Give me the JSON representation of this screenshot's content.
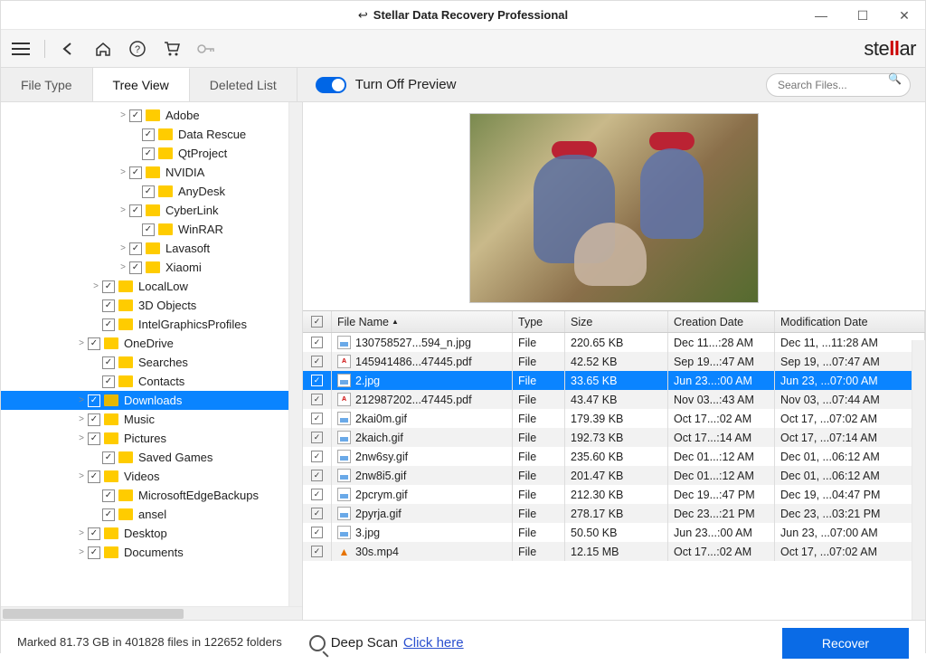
{
  "window": {
    "title": "Stellar Data Recovery Professional"
  },
  "brand": {
    "pre": "ste",
    "mid": "ll",
    "post": "ar"
  },
  "tabs": {
    "file_type": "File Type",
    "tree_view": "Tree View",
    "deleted_list": "Deleted List"
  },
  "preview_toggle_label": "Turn Off Preview",
  "search": {
    "placeholder": "Search Files..."
  },
  "tree": [
    {
      "indent": 128,
      "chev": ">",
      "label": "Adobe"
    },
    {
      "indent": 142,
      "chev": "",
      "label": "Data Rescue"
    },
    {
      "indent": 142,
      "chev": "",
      "label": "QtProject"
    },
    {
      "indent": 128,
      "chev": ">",
      "label": "NVIDIA"
    },
    {
      "indent": 142,
      "chev": "",
      "label": "AnyDesk"
    },
    {
      "indent": 128,
      "chev": ">",
      "label": "CyberLink"
    },
    {
      "indent": 142,
      "chev": "",
      "label": "WinRAR"
    },
    {
      "indent": 128,
      "chev": ">",
      "label": "Lavasoft"
    },
    {
      "indent": 128,
      "chev": ">",
      "label": "Xiaomi"
    },
    {
      "indent": 98,
      "chev": ">",
      "label": "LocalLow"
    },
    {
      "indent": 98,
      "chev": "",
      "label": "3D Objects"
    },
    {
      "indent": 98,
      "chev": "",
      "label": "IntelGraphicsProfiles"
    },
    {
      "indent": 82,
      "chev": ">",
      "label": "OneDrive"
    },
    {
      "indent": 98,
      "chev": "",
      "label": "Searches"
    },
    {
      "indent": 98,
      "chev": "",
      "label": "Contacts"
    },
    {
      "indent": 82,
      "chev": ">",
      "label": "Downloads",
      "selected": true,
      "open": true
    },
    {
      "indent": 82,
      "chev": ">",
      "label": "Music"
    },
    {
      "indent": 82,
      "chev": ">",
      "label": "Pictures"
    },
    {
      "indent": 98,
      "chev": "",
      "label": "Saved Games"
    },
    {
      "indent": 82,
      "chev": ">",
      "label": "Videos"
    },
    {
      "indent": 98,
      "chev": "",
      "label": "MicrosoftEdgeBackups"
    },
    {
      "indent": 98,
      "chev": "",
      "label": "ansel"
    },
    {
      "indent": 82,
      "chev": ">",
      "label": "Desktop"
    },
    {
      "indent": 82,
      "chev": ">",
      "label": "Documents"
    }
  ],
  "table": {
    "headers": {
      "name": "File Name",
      "type": "Type",
      "size": "Size",
      "cd": "Creation Date",
      "md": "Modification Date"
    },
    "rows": [
      {
        "icon": "img",
        "name": "130758527...594_n.jpg",
        "type": "File",
        "size": "220.65 KB",
        "cd": "Dec 11...:28 AM",
        "md": "Dec 11, ...11:28 AM"
      },
      {
        "icon": "pdf",
        "name": "145941486...47445.pdf",
        "type": "File",
        "size": "42.52 KB",
        "cd": "Sep 19...:47 AM",
        "md": "Sep 19, ...07:47 AM"
      },
      {
        "icon": "img",
        "name": "2.jpg",
        "type": "File",
        "size": "33.65 KB",
        "cd": "Jun 23...:00 AM",
        "md": "Jun 23, ...07:00 AM",
        "selected": true
      },
      {
        "icon": "pdf",
        "name": "212987202...47445.pdf",
        "type": "File",
        "size": "43.47 KB",
        "cd": "Nov 03...:43 AM",
        "md": "Nov 03, ...07:44 AM"
      },
      {
        "icon": "img",
        "name": "2kai0m.gif",
        "type": "File",
        "size": "179.39 KB",
        "cd": "Oct 17...:02 AM",
        "md": "Oct 17, ...07:02 AM"
      },
      {
        "icon": "img",
        "name": "2kaich.gif",
        "type": "File",
        "size": "192.73 KB",
        "cd": "Oct 17...:14 AM",
        "md": "Oct 17, ...07:14 AM"
      },
      {
        "icon": "img",
        "name": "2nw6sy.gif",
        "type": "File",
        "size": "235.60 KB",
        "cd": "Dec 01...:12 AM",
        "md": "Dec 01, ...06:12 AM"
      },
      {
        "icon": "img",
        "name": "2nw8i5.gif",
        "type": "File",
        "size": "201.47 KB",
        "cd": "Dec 01...:12 AM",
        "md": "Dec 01, ...06:12 AM"
      },
      {
        "icon": "img",
        "name": "2pcrym.gif",
        "type": "File",
        "size": "212.30 KB",
        "cd": "Dec 19...:47 PM",
        "md": "Dec 19, ...04:47 PM"
      },
      {
        "icon": "img",
        "name": "2pyrja.gif",
        "type": "File",
        "size": "278.17 KB",
        "cd": "Dec 23...:21 PM",
        "md": "Dec 23, ...03:21 PM"
      },
      {
        "icon": "img",
        "name": "3.jpg",
        "type": "File",
        "size": "50.50 KB",
        "cd": "Jun 23...:00 AM",
        "md": "Jun 23, ...07:00 AM"
      },
      {
        "icon": "vid",
        "name": "30s.mp4",
        "type": "File",
        "size": "12.15 MB",
        "cd": "Oct 17...:02 AM",
        "md": "Oct 17, ...07:02 AM"
      }
    ]
  },
  "status": "Marked 81.73 GB in 401828 files in 122652 folders",
  "deep_scan": {
    "label": "Deep Scan",
    "link": "Click here"
  },
  "recover_label": "Recover"
}
